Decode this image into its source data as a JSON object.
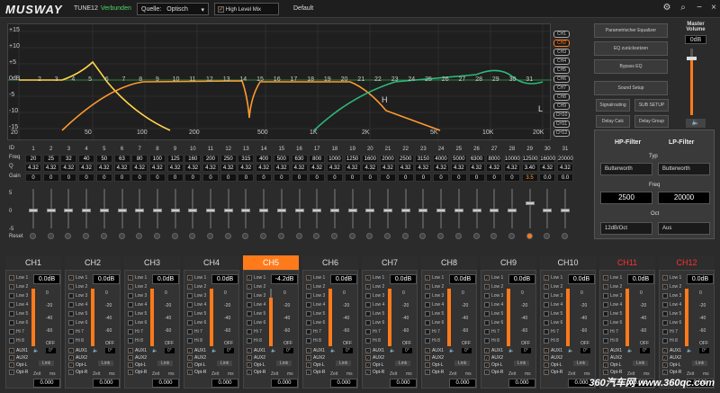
{
  "topbar": {
    "logo": "MUSWAY",
    "model": "TUNE12",
    "status": "Verbunden",
    "source_label": "Quelle:",
    "source_value": "Optisch",
    "hlm_label": "High Level Mix",
    "preset": "Default"
  },
  "graph": {
    "y_labels": [
      "+15",
      "+10",
      "+5",
      "0dB",
      "-5",
      "-10",
      "-15"
    ],
    "x_labels": [
      "20",
      "50",
      "100",
      "200",
      "500",
      "1K",
      "2K",
      "5K",
      "10K",
      "20K"
    ],
    "band_numbers": [
      "2",
      "3",
      "4",
      "5",
      "6",
      "7",
      "8",
      "9",
      "10",
      "11",
      "12",
      "13",
      "14",
      "15",
      "16",
      "17",
      "18",
      "19",
      "20",
      "21",
      "22",
      "23",
      "24",
      "25",
      "26",
      "27",
      "28",
      "29",
      "30",
      "31"
    ],
    "markers": [
      "H",
      "L"
    ]
  },
  "channel_checks": [
    "CH1",
    "CH2",
    "CH3",
    "CH4",
    "CH5",
    "CH6",
    "CH7",
    "CH8",
    "CH9",
    "CH10",
    "CH11",
    "CH12"
  ],
  "right_buttons": {
    "param_eq": "Parametrischer Equalizer",
    "reset_eq": "EQ zurücksetzen",
    "bypass_eq": "Bypass EQ",
    "sound_setup": "Sound Setup",
    "signal_routing": "Signalrouting",
    "sub_setup": "SUB SETUP",
    "delay_calc": "Delay Calc",
    "delay_group": "Delay Group"
  },
  "master": {
    "label": "Master Volume",
    "value": "0dB",
    "level": 0.85
  },
  "eq_table": {
    "row_labels": [
      "ID",
      "Freq",
      "Q",
      "Gain"
    ],
    "ids": [
      "1",
      "2",
      "3",
      "4",
      "5",
      "6",
      "7",
      "8",
      "9",
      "10",
      "11",
      "12",
      "13",
      "14",
      "15",
      "16",
      "17",
      "18",
      "19",
      "20",
      "21",
      "22",
      "23",
      "24",
      "25",
      "26",
      "27",
      "28",
      "29",
      "30",
      "31"
    ],
    "freqs": [
      "20",
      "25",
      "32",
      "40",
      "50",
      "63",
      "80",
      "100",
      "125",
      "160",
      "200",
      "250",
      "315",
      "400",
      "500",
      "630",
      "800",
      "1000",
      "1250",
      "1600",
      "2000",
      "2500",
      "3150",
      "4000",
      "5000",
      "6300",
      "8000",
      "10000",
      "12500",
      "16000",
      "20000"
    ],
    "qs": [
      "4.32",
      "4.32",
      "4.32",
      "4.32",
      "4.32",
      "4.32",
      "4.32",
      "4.32",
      "4.32",
      "4.32",
      "4.32",
      "4.32",
      "4.32",
      "4.32",
      "4.32",
      "4.32",
      "4.32",
      "4.32",
      "4.32",
      "4.32",
      "4.32",
      "4.32",
      "4.32",
      "4.32",
      "4.32",
      "4.32",
      "4.32",
      "4.32",
      "3.40",
      "4.32",
      "4.32"
    ],
    "gains": [
      "0",
      "0",
      "0",
      "0",
      "0",
      "0",
      "0",
      "0",
      "0",
      "0",
      "0",
      "0",
      "0",
      "0",
      "0",
      "0",
      "0",
      "0",
      "0",
      "0",
      "0",
      "0",
      "0",
      "0",
      "0",
      "0",
      "0",
      "0",
      "3.5",
      "0.0",
      "0.0"
    ],
    "fader_scale": [
      "5",
      "0",
      "-5"
    ],
    "reset_label": "Reset"
  },
  "filter": {
    "hp": "HP-Filter",
    "lp": "LP-Filter",
    "type_label": "Typ",
    "hp_type": "Butterworth",
    "lp_type": "Butterworth",
    "freq_label": "Freq",
    "hp_freq": "2500",
    "lp_freq": "20000",
    "oct_label": "Oct",
    "hp_oct": "12dB/Oct",
    "lp_oct": "Aus"
  },
  "channels": [
    {
      "name": "CH1",
      "db": "0.0dB",
      "delay": "0.000",
      "red": false,
      "active": false
    },
    {
      "name": "CH2",
      "db": "0.0dB",
      "delay": "0.000",
      "red": false,
      "active": false
    },
    {
      "name": "CH3",
      "db": "0.0dB",
      "delay": "0.000",
      "red": false,
      "active": false
    },
    {
      "name": "CH4",
      "db": "0.0dB",
      "delay": "0.000",
      "red": false,
      "active": false
    },
    {
      "name": "CH5",
      "db": "-4.2dB",
      "delay": "0.000",
      "red": false,
      "active": true
    },
    {
      "name": "CH6",
      "db": "0.0dB",
      "delay": "0.000",
      "red": false,
      "active": false
    },
    {
      "name": "CH7",
      "db": "0.0dB",
      "delay": "0.000",
      "red": false,
      "active": false
    },
    {
      "name": "CH8",
      "db": "0.0dB",
      "delay": "0.000",
      "red": false,
      "active": false
    },
    {
      "name": "CH9",
      "db": "0.0dB",
      "delay": "0.000",
      "red": false,
      "active": false
    },
    {
      "name": "CH10",
      "db": "0.0dB",
      "delay": "0.000",
      "red": false,
      "active": false
    },
    {
      "name": "CH11",
      "db": "0.0dB",
      "delay": "0.000",
      "red": true,
      "active": false
    },
    {
      "name": "CH12",
      "db": "0.0dB",
      "delay": "0.000",
      "red": true,
      "active": false
    }
  ],
  "strip_labels": {
    "inputs": [
      "Low 1",
      "Low 2",
      "Low 3",
      "Low 4",
      "Low 5",
      "Low 6",
      "Hi 7",
      "Hi 8"
    ],
    "aux1": "AUX1",
    "aux2": "AUX2",
    "opt_l": "Opt-L",
    "opt_r": "Opt-R",
    "bt_l": "BT-L",
    "bt_r": "BT-R",
    "link": "Link",
    "zero": "0°",
    "zeit": "Zeit",
    "ms": "ms",
    "scale": [
      "0",
      "-20",
      "-40",
      "-60",
      "OFF"
    ]
  },
  "watermark": "360汽车网 www.360qc.com",
  "colors": {
    "accent": "#ff7a1a",
    "green": "#2db87a",
    "red_label": "#ff3030"
  }
}
